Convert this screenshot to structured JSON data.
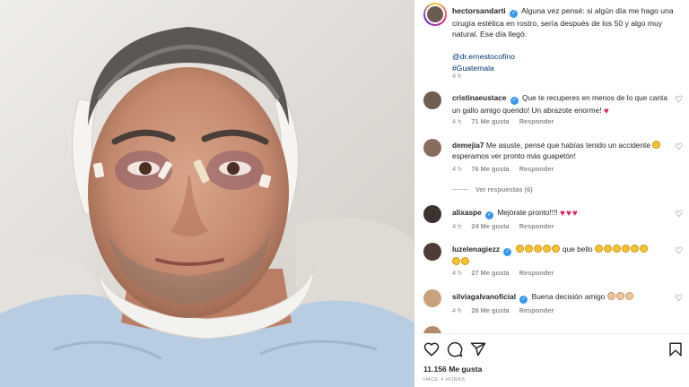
{
  "post": {
    "author": "hectorsandarti",
    "caption": "Alguna vez pensé: si algún día me hago una cirugía estética en rostro, sería después de los 50 y algo muy natural. Ese día llegó.",
    "mention": "@dr.ernestocofino",
    "hashtag": "#Guatemala",
    "age": "4 h"
  },
  "comments": [
    {
      "user": "cristinaeustace",
      "verified": true,
      "text": "Que te recuperes en menos de lo que canta un gallo amigo querido! Un abrazote enorme!",
      "time": "4 h",
      "likes": "71 Me gusta",
      "reply": "Responder"
    },
    {
      "user": "demejia7",
      "verified": false,
      "text": "Me asuste, pensé que habías tenido un accidente",
      "text2": "esperamos ver pronto más guapetón!",
      "time": "4 h",
      "likes": "76 Me gusta",
      "reply": "Responder",
      "view_replies": "Ver respuestas (6)"
    },
    {
      "user": "alixaspe",
      "verified": true,
      "text": "Mejórate pronto!!!!",
      "time": "4 h",
      "likes": "24 Me gusta",
      "reply": "Responder"
    },
    {
      "user": "luzelenagiezz",
      "verified": true,
      "text": "que bello",
      "time": "4 h",
      "likes": "27 Me gusta",
      "reply": "Responder"
    },
    {
      "user": "silviagalvanoficial",
      "verified": true,
      "text": "Buena decisión amigo",
      "time": "4 h",
      "likes": "28 Me gusta",
      "reply": "Responder"
    }
  ],
  "footer": {
    "likes": "11.156 Me gusta",
    "time": "HACE 4 HORAS"
  },
  "colors": {
    "accent": "#3897f0",
    "heart": "#e0245e",
    "link": "#00376b",
    "muted": "#8e8e8e"
  },
  "icons": [
    "heart-icon",
    "comment-icon",
    "share-icon",
    "save-icon",
    "verified-badge-icon"
  ]
}
